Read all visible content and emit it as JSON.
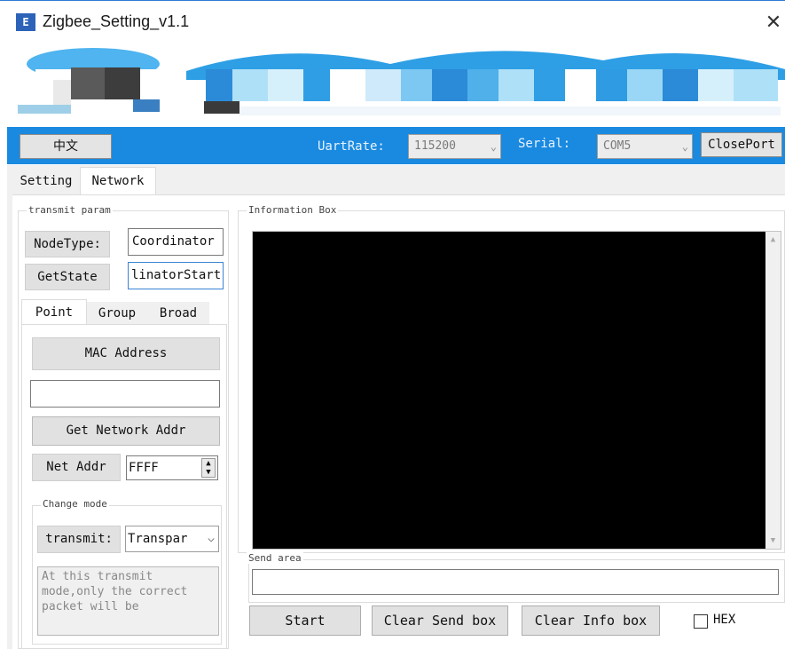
{
  "window": {
    "title": "Zigbee_Setting_v1.1",
    "app_icon_text": "E",
    "close_glyph": "✕"
  },
  "toolbar": {
    "language_button": "中文",
    "uart_rate_label": "UartRate:",
    "uart_rate_value": "115200",
    "serial_label": "Serial:",
    "serial_value": "COM5",
    "close_port_button": "ClosePort"
  },
  "tabs": [
    "Setting",
    "Network"
  ],
  "transmit_param": {
    "group_label": "transmit param",
    "node_type_label": "NodeType:",
    "node_type_value": "Coordinator",
    "get_state_button": "GetState",
    "state_value": "linatorStart"
  },
  "sub_tabs": [
    "Point",
    "Group",
    "Broad"
  ],
  "point": {
    "mac_address_button": "MAC Address",
    "mac_address_value": "",
    "get_network_addr_button": "Get Network Addr",
    "net_addr_label": "Net Addr",
    "net_addr_value": "FFFF"
  },
  "change_mode": {
    "group_label": "Change mode",
    "transmit_label": "transmit:",
    "transmit_value": "Transpar",
    "description": "At this transmit mode,only the correct packet will be"
  },
  "info_box": {
    "label": "Information Box",
    "content": ""
  },
  "send_area": {
    "label": "Send area",
    "value": ""
  },
  "actions": {
    "start_button": "Start",
    "clear_send_button": "Clear Send box",
    "clear_info_button": "Clear Info box",
    "hex_label": "HEX",
    "hex_checked": false
  }
}
